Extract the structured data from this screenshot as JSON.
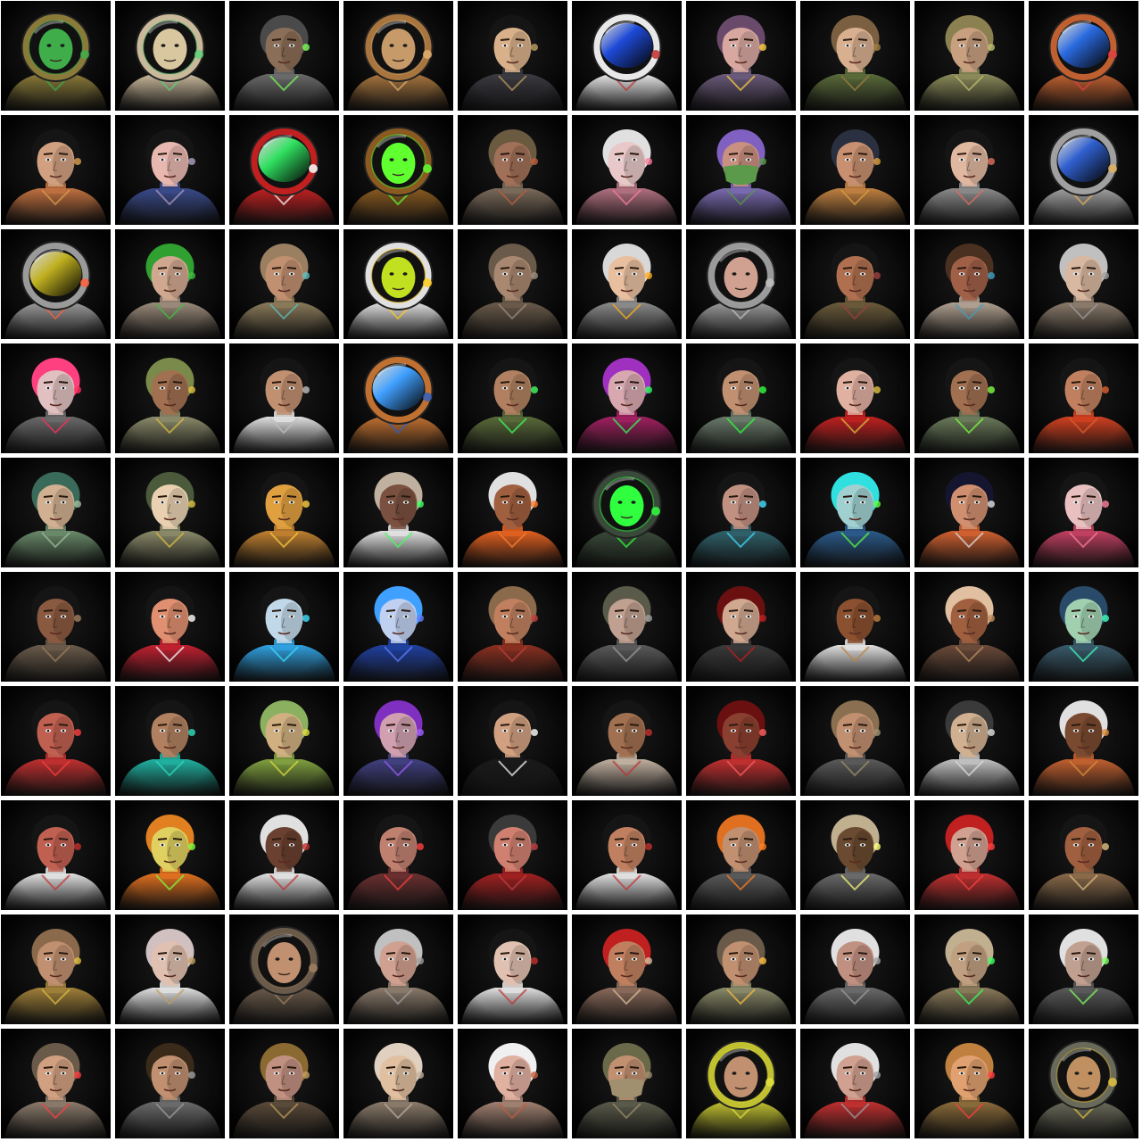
{
  "grid": {
    "rows": 10,
    "cols": 10,
    "background_color": "#ffffff",
    "tile_color": "#050505"
  },
  "portraits": [
    {
      "type": "helmet",
      "visor": "#3fae4a",
      "suit": "#8a7a3a",
      "accent": "#3fae4a"
    },
    {
      "type": "helmet",
      "visor": "#d9c7a0",
      "suit": "#c9b89a",
      "accent": "#5fd07a"
    },
    {
      "type": "face",
      "skin": "#8a6e58",
      "hair": "#4a4a4a",
      "suit": "#6a6a6a",
      "accent": "#7cff5a"
    },
    {
      "type": "helmet",
      "visor": "#c79a6a",
      "suit": "#a8753e",
      "accent": "#e0b070"
    },
    {
      "type": "face",
      "skin": "#d8b08a",
      "hair": "#151515",
      "suit": "#3a3a40",
      "accent": "#c0a060"
    },
    {
      "type": "visor",
      "visor": "#1e4ad8",
      "suit": "#e8e8e8",
      "accent": "#c03030"
    },
    {
      "type": "face",
      "skin": "#d8a8a0",
      "hair": "#6a4a6a",
      "suit": "#6a5a7a",
      "accent": "#ffd040"
    },
    {
      "type": "face",
      "skin": "#d8b090",
      "hair": "#7a6040",
      "suit": "#5a6a3a",
      "accent": "#a08040"
    },
    {
      "type": "face",
      "skin": "#c8a080",
      "hair": "#8a8050",
      "suit": "#8a8a5a",
      "accent": "#c0c070"
    },
    {
      "type": "visor",
      "visor": "#2a6ae0",
      "suit": "#c06030",
      "accent": "#e04040"
    },
    {
      "type": "face",
      "skin": "#d0a080",
      "hair": "#151515",
      "suit": "#c07040",
      "accent": "#e0a050"
    },
    {
      "type": "face",
      "skin": "#e8b8b0",
      "hair": "#151515",
      "suit": "#3a4a8a",
      "accent": "#b0a0c0"
    },
    {
      "type": "visor",
      "visor": "#30e060",
      "suit": "#c02020",
      "accent": "#ffffff"
    },
    {
      "type": "helmet",
      "visor": "#60ff30",
      "suit": "#8a5a20",
      "accent": "#60ff30"
    },
    {
      "type": "face",
      "skin": "#a07058",
      "hair": "#6a5a40",
      "suit": "#7a6a5a",
      "accent": "#c06040"
    },
    {
      "type": "face",
      "skin": "#e8c8c8",
      "hair": "#e0e0e0",
      "suit": "#b07080",
      "accent": "#ff80a0"
    },
    {
      "type": "mask",
      "skin": "#c89080",
      "hair": "#8060c0",
      "suit": "#7a6ab0",
      "accent": "#5a9a4a"
    },
    {
      "type": "face",
      "skin": "#c89070",
      "hair": "#2a3040",
      "suit": "#c08040",
      "accent": "#e0a040"
    },
    {
      "type": "face",
      "skin": "#e0b8a0",
      "hair": "#151515",
      "suit": "#8a8a8a",
      "accent": "#e07060"
    },
    {
      "type": "visor",
      "visor": "#3060d0",
      "suit": "#a0a0a0",
      "accent": "#e0b060"
    },
    {
      "type": "visor",
      "visor": "#c0b020",
      "suit": "#9a9a9a",
      "accent": "#ff6040"
    },
    {
      "type": "face",
      "skin": "#d0a890",
      "hair": "#30a030",
      "suit": "#9a8a7a",
      "accent": "#40c040"
    },
    {
      "type": "face",
      "skin": "#c09070",
      "hair": "#9a8060",
      "suit": "#8a7a5a",
      "accent": "#60c0c0"
    },
    {
      "type": "helmet",
      "visor": "#c0e020",
      "suit": "#e0e0e0",
      "accent": "#ffcc20"
    },
    {
      "type": "face",
      "skin": "#a88870",
      "hair": "#6a5a4a",
      "suit": "#6a5a4a",
      "accent": "#a09080"
    },
    {
      "type": "face",
      "skin": "#e8c0a0",
      "hair": "#d8d8d8",
      "suit": "#8a8a8a",
      "accent": "#ffb020"
    },
    {
      "type": "helmet",
      "visor": "#d0a090",
      "suit": "#9a9a9a",
      "accent": "#c0c0c0"
    },
    {
      "type": "face",
      "skin": "#b07050",
      "hair": "#151515",
      "suit": "#6a5a3a",
      "accent": "#a04040"
    },
    {
      "type": "face",
      "skin": "#a06048",
      "hair": "#4a3020",
      "suit": "#b0a090",
      "accent": "#40a0c0"
    },
    {
      "type": "face",
      "skin": "#d8b8a0",
      "hair": "#c0c0c0",
      "suit": "#8a7a6a",
      "accent": "#a0a0a0"
    },
    {
      "type": "face",
      "skin": "#e0c0c0",
      "hair": "#ff4080",
      "suit": "#6a6a6a",
      "accent": "#ff3060"
    },
    {
      "type": "face",
      "skin": "#a07050",
      "hair": "#7a8a4a",
      "suit": "#8a8a6a",
      "accent": "#e0c040"
    },
    {
      "type": "face",
      "skin": "#c09070",
      "hair": "#151515",
      "suit": "#e0e0e0",
      "accent": "#c0c0c0"
    },
    {
      "type": "visor",
      "visor": "#40a0ff",
      "suit": "#c07030",
      "accent": "#3060c0"
    },
    {
      "type": "face",
      "skin": "#b08060",
      "hair": "#151515",
      "suit": "#5a6a3a",
      "accent": "#40ff60"
    },
    {
      "type": "face",
      "skin": "#d8a8b0",
      "hair": "#a030c0",
      "suit": "#a02060",
      "accent": "#30ff60"
    },
    {
      "type": "face",
      "skin": "#c09070",
      "hair": "#151515",
      "suit": "#6a7a6a",
      "accent": "#30ff40"
    },
    {
      "type": "face",
      "skin": "#e0b0a0",
      "hair": "#151515",
      "suit": "#c02020",
      "accent": "#e0c040"
    },
    {
      "type": "face",
      "skin": "#a07050",
      "hair": "#151515",
      "suit": "#6a7a5a",
      "accent": "#80ff40"
    },
    {
      "type": "face",
      "skin": "#c08060",
      "hair": "#151515",
      "suit": "#d04020",
      "accent": "#e06030"
    },
    {
      "type": "face",
      "skin": "#d0b090",
      "hair": "#3a6a5a",
      "suit": "#6a8a6a",
      "accent": "#a0c0a0"
    },
    {
      "type": "face",
      "skin": "#e8d0b0",
      "hair": "#4a5a3a",
      "suit": "#8a8a6a",
      "accent": "#e0c040"
    },
    {
      "type": "face",
      "skin": "#e0a040",
      "hair": "#151515",
      "suit": "#c08030",
      "accent": "#ffd040"
    },
    {
      "type": "face",
      "skin": "#7a5040",
      "hair": "#c0b0a0",
      "suit": "#e0e0e0",
      "accent": "#40ff60"
    },
    {
      "type": "face",
      "skin": "#a06040",
      "hair": "#e0e0e0",
      "suit": "#e06020",
      "accent": "#ff8030"
    },
    {
      "type": "helmet",
      "visor": "#30ff40",
      "suit": "#3a4a3a",
      "accent": "#30ff40"
    },
    {
      "type": "face",
      "skin": "#c09080",
      "hair": "#151515",
      "suit": "#30606a",
      "accent": "#40e0ff"
    },
    {
      "type": "face",
      "skin": "#a0d0d0",
      "hair": "#30e0e0",
      "suit": "#2a5a8a",
      "accent": "#60ff40"
    },
    {
      "type": "face",
      "skin": "#d09070",
      "hair": "#151530",
      "suit": "#d06030",
      "accent": "#e0e0e0"
    },
    {
      "type": "face",
      "skin": "#e8c0c0",
      "hair": "#151515",
      "suit": "#c04060",
      "accent": "#ff80a0"
    },
    {
      "type": "face",
      "skin": "#8a5a40",
      "hair": "#151515",
      "suit": "#6a5a4a",
      "accent": "#a08060"
    },
    {
      "type": "face",
      "skin": "#e09070",
      "hair": "#151515",
      "suit": "#c02030",
      "accent": "#ffffff"
    },
    {
      "type": "face",
      "skin": "#c0d8e8",
      "hair": "#151515",
      "suit": "#30a0e0",
      "accent": "#40e0ff"
    },
    {
      "type": "face",
      "skin": "#c0d0f0",
      "hair": "#40a0ff",
      "suit": "#2040a0",
      "accent": "#6080ff"
    },
    {
      "type": "face",
      "skin": "#c08060",
      "hair": "#8a6a4a",
      "suit": "#8a3020",
      "accent": "#c04040"
    },
    {
      "type": "face",
      "skin": "#c0a090",
      "hair": "#5a5a4a",
      "suit": "#5a5a5a",
      "accent": "#a0a0a0"
    },
    {
      "type": "face",
      "skin": "#d0a890",
      "hair": "#6a1010",
      "suit": "#3a3a3a",
      "accent": "#c02020"
    },
    {
      "type": "face",
      "skin": "#8a5030",
      "hair": "#151515",
      "suit": "#e0e0e0",
      "accent": "#c08040"
    },
    {
      "type": "face",
      "skin": "#a06040",
      "hair": "#e0c0a0",
      "suit": "#6a4a3a",
      "accent": "#c09060"
    },
    {
      "type": "face",
      "skin": "#a0d0b0",
      "hair": "#2a4a6a",
      "suit": "#3a5a6a",
      "accent": "#40ffc0"
    },
    {
      "type": "face",
      "skin": "#c06050",
      "hair": "#151515",
      "suit": "#c03030",
      "accent": "#ff4040"
    },
    {
      "type": "face",
      "skin": "#b08060",
      "hair": "#151515",
      "suit": "#20b0a0",
      "accent": "#30e0c0"
    },
    {
      "type": "face",
      "skin": "#d0b080",
      "hair": "#8ab060",
      "suit": "#80a040",
      "accent": "#e0e040"
    },
    {
      "type": "face",
      "skin": "#d0a0b0",
      "hair": "#8030c0",
      "suit": "#404080",
      "accent": "#a060ff"
    },
    {
      "type": "face",
      "skin": "#d0a080",
      "hair": "#151515",
      "suit": "#1a1a1a",
      "accent": "#ffffff"
    },
    {
      "type": "face",
      "skin": "#a07050",
      "hair": "#151515",
      "suit": "#c0b0a0",
      "accent": "#c03030"
    },
    {
      "type": "face",
      "skin": "#8a4030",
      "hair": "#6a1010",
      "suit": "#c03030",
      "accent": "#ff6060"
    },
    {
      "type": "face",
      "skin": "#c09070",
      "hair": "#8a7050",
      "suit": "#5a5a5a",
      "accent": "#a09070"
    },
    {
      "type": "face",
      "skin": "#d0b090",
      "hair": "#3a3a3a",
      "suit": "#c0c0c0",
      "accent": "#e0e0e0"
    },
    {
      "type": "face",
      "skin": "#7a4a30",
      "hair": "#e0e0e0",
      "suit": "#c06030",
      "accent": "#e09040"
    },
    {
      "type": "face",
      "skin": "#c06050",
      "hair": "#151515",
      "suit": "#e0e0e0",
      "accent": "#c03030"
    },
    {
      "type": "face",
      "skin": "#e0d060",
      "hair": "#e08020",
      "suit": "#e07020",
      "accent": "#80ff40"
    },
    {
      "type": "face",
      "skin": "#6a4030",
      "hair": "#e0e0e0",
      "suit": "#e0e0e0",
      "accent": "#c03030"
    },
    {
      "type": "face",
      "skin": "#c08070",
      "hair": "#151515",
      "suit": "#6a3030",
      "accent": "#ff4040"
    },
    {
      "type": "face",
      "skin": "#d08070",
      "hair": "#3a3a3a",
      "suit": "#a02020",
      "accent": "#c04040"
    },
    {
      "type": "face",
      "skin": "#c08060",
      "hair": "#151515",
      "suit": "#e0e0e0",
      "accent": "#c03030"
    },
    {
      "type": "face",
      "skin": "#c09070",
      "hair": "#e07020",
      "suit": "#5a5a5a",
      "accent": "#ff8020"
    },
    {
      "type": "face",
      "skin": "#6a4a30",
      "hair": "#c0b090",
      "suit": "#6a6a6a",
      "accent": "#ffff80"
    },
    {
      "type": "face",
      "skin": "#d0a090",
      "hair": "#c02020",
      "suit": "#c03030",
      "accent": "#ff4040"
    },
    {
      "type": "face",
      "skin": "#a06040",
      "hair": "#151515",
      "suit": "#8a6a4a",
      "accent": "#e0c080"
    },
    {
      "type": "face",
      "skin": "#c09070",
      "hair": "#8a6a4a",
      "suit": "#a0803a",
      "accent": "#e0c040"
    },
    {
      "type": "face",
      "skin": "#e0c0b0",
      "hair": "#d0c0c0",
      "suit": "#e0e0e0",
      "accent": "#c0a060"
    },
    {
      "type": "helmet",
      "visor": "#c09070",
      "suit": "#6a5a4a",
      "accent": "#a08060"
    },
    {
      "type": "face",
      "skin": "#d0a090",
      "hair": "#c0c0c0",
      "suit": "#8a7a6a",
      "accent": "#a0a0a0"
    },
    {
      "type": "face",
      "skin": "#e0c0b0",
      "hair": "#151515",
      "suit": "#e0e0e0",
      "accent": "#c03030"
    },
    {
      "type": "face",
      "skin": "#c08060",
      "hair": "#c02020",
      "suit": "#8a6a5a",
      "accent": "#e0c0a0"
    },
    {
      "type": "face",
      "skin": "#c09070",
      "hair": "#6a5a4a",
      "suit": "#8a8a6a",
      "accent": "#ffc040"
    },
    {
      "type": "face",
      "skin": "#c09080",
      "hair": "#e0e0e0",
      "suit": "#6a6a6a",
      "accent": "#a0a0a0"
    },
    {
      "type": "face",
      "skin": "#c0a080",
      "hair": "#c0b090",
      "suit": "#8a7a5a",
      "accent": "#40ff60"
    },
    {
      "type": "face",
      "skin": "#c0a090",
      "hair": "#e0e0e0",
      "suit": "#5a5a5a",
      "accent": "#80ff60"
    },
    {
      "type": "face",
      "skin": "#d0a080",
      "hair": "#6a5a4a",
      "suit": "#8a7a6a",
      "accent": "#ff4040"
    },
    {
      "type": "face",
      "skin": "#c09070",
      "hair": "#3a2a1a",
      "suit": "#6a6a6a",
      "accent": "#a0a0a0"
    },
    {
      "type": "face",
      "skin": "#c09080",
      "hair": "#8a6a30",
      "suit": "#5a4a3a",
      "accent": "#c0a060"
    },
    {
      "type": "face",
      "skin": "#e0c0a0",
      "hair": "#e0d0c0",
      "suit": "#8a7a6a",
      "accent": "#c0b0a0"
    },
    {
      "type": "face",
      "skin": "#e0b0a0",
      "hair": "#f0f0f0",
      "suit": "#a08070",
      "accent": "#c06040"
    },
    {
      "type": "mask",
      "skin": "#c09070",
      "hair": "#6a6a4a",
      "suit": "#5a5a4a",
      "accent": "#a09070"
    },
    {
      "type": "helmet",
      "visor": "#c09070",
      "suit": "#c0c030",
      "accent": "#e0e040"
    },
    {
      "type": "face",
      "skin": "#d0a090",
      "hair": "#e0e0e0",
      "suit": "#c03030",
      "accent": "#a0a0a0"
    },
    {
      "type": "face",
      "skin": "#e0a070",
      "hair": "#c08040",
      "suit": "#8a6a3a",
      "accent": "#ff4040"
    },
    {
      "type": "helmet",
      "visor": "#c09060",
      "suit": "#6a6a5a",
      "accent": "#e0c040"
    }
  ]
}
